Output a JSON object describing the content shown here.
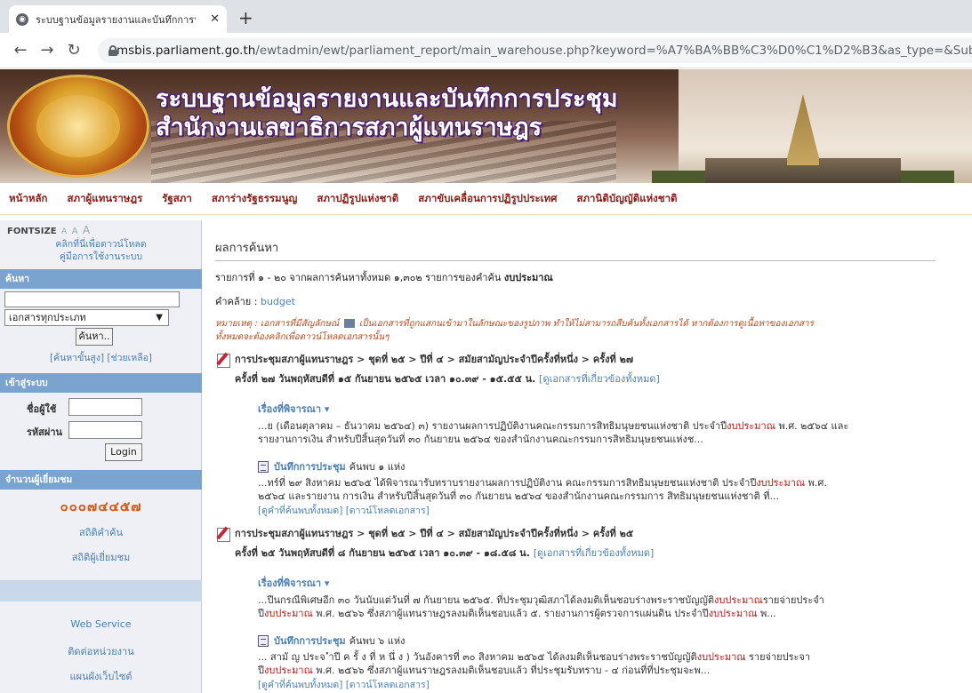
{
  "browser": {
    "tab_title": "ระบบฐานข้อมูลรายงานและบันทึกการประชุม",
    "url_host": "msbis.parliament.go.th",
    "url_path": "/ewtadmin/ewt/parliament_report/main_warehouse.php?keyword=%A7%BA%BB%C3%D0%C1%D2%B3&as_type=&Submit=%A"
  },
  "banner": {
    "title_line1": "ระบบฐานข้อมูลรายงานและบันทึกการประชุม",
    "title_line2": "สำนักงานเลขาธิการสภาผู้แทนราษฎร"
  },
  "topnav": [
    "หน้าหลัก",
    "สภาผู้แทนราษฎร",
    "รัฐสภา",
    "สภาร่างรัฐธรรมนูญ",
    "สภาปฏิรูปแห่งชาติ",
    "สภาขับเคลื่อนการปฏิรูปประเทศ",
    "สภานิติบัญญัติแห่งชาติ"
  ],
  "sidebar": {
    "fontsize_label": "FONTSIZE",
    "fontsize_options": [
      "A",
      "A",
      "A"
    ],
    "manual_line1": "คลิกที่นี่เพื่อดาวน์โหลด",
    "manual_line2": "คู่มือการใช้งานระบบ",
    "search_head": "ค้นหา",
    "search_value": "",
    "doc_type_selected": "เอกสารทุกประเภท",
    "search_button": "ค้นหา..",
    "adv_search": "[ค้นหาขั้นสูง]",
    "help": "[ช่วยเหลือ]",
    "login_head": "เข้าสู่ระบบ",
    "username_label": "ชื่อผู้ใช้",
    "password_label": "รหัสผ่าน",
    "login_button": "Login",
    "visitors_head": "จำนวนผู้เยี่ยมชม",
    "visitor_count": "๐๐๐๗๔๔๕๗",
    "search_stats": "สถิติคำค้น",
    "visitor_stats": "สถิติผู้เยี่ยมชม",
    "web_service": "Web Service",
    "contact": "ติดต่อหน่วยงาน",
    "sitemap": "แผนผังเว็บไซต์"
  },
  "main": {
    "title": "ผลการค้นหา",
    "summary_prefix": "รายการที่ ๑ - ๒๐ จากผลการค้นหาทั้งหมด ๑,๓๐๒ รายการของคำค้น ",
    "summary_keyword": "งบประมาณ",
    "similar_label": "คำคล้าย : ",
    "similar_word": "budget",
    "note_prefix": "หมายเหตุ : เอกสารที่มีสัญลักษณ์",
    "note_suffix": "เป็นเอกสารที่ถูกแสกนเข้ามาในลักษณะของรูปภาพ ทำให้ไม่สามารถสืบค้นทั้งเอกสารได้ หากต้องการดูเนื้อหาของเอกสาร",
    "note_line2": "ทั้งหมดจะต้องคลิกเพื่อดาวน์โหลดเอกสารนั้นๆ",
    "results": [
      {
        "path": "การประชุมสภาผู้แทนราษฎร > ชุดที่ ๒๕ > ปีที่ ๔ > สมัยสามัญประจำปีครั้งที่หนึ่ง > ครั้งที่ ๒๗",
        "session": "ครั้งที่ ๒๗ วันพฤหัสบดีที่ ๑๕ กันยายน ๒๕๖๕ เวลา ๑๐.๓๙ - ๑๕.๕๕ น. ",
        "related_link": "[ดูเอกสารที่เกี่ยวข้องทั้งหมด]",
        "topic_label": "เรื่องที่พิจารณา ▾",
        "topic_s1": "...ย (เดือนตุลาคม – ธันวาคม ๒๕๖๔) ๓) รายงานผลการปฏิบัติงานคณะกรรมการสิทธิมนุษยชนแห่งชาติ ประจำปี",
        "topic_hl": "งบประมาณ",
        "topic_s2": " พ.ศ. ๒๕๖๔ และ",
        "topic_line2": "รายงานการเงิน สำหรับปีสิ้นสุดวันที่ ๓๐ กันยายน ๒๕๖๔ ของสำนักงานคณะกรรมการสิทธิมนุษยชนแห่งช...",
        "minutes_label": "บันทึกการประชุม",
        "minutes_found": "ค้นพบ ๑ แห่ง",
        "minutes_s1": "...ทร์ที่ ๒๙ สิงหาคม ๒๕๖๕ ได้พิจารณารับทราบรายงานผลการปฏิบัติงาน คณะกรรมการสิทธิมนุษยชนแห่งชาติ ประจำปี",
        "minutes_hl": "งบประมาณ",
        "minutes_s2": " พ.ศ.",
        "minutes_line2": "๒๕๖๔ และรายงาน การเงิน สำหรับปีสิ้นสุดวันที่ ๓๐ กันยายน ๒๕๖๔ ของสำนักงานคณะกรรมการ สิทธิมนุษยชนแห่งชาติ ที่...",
        "view_all": "[ดูคำที่ค้นพบทั้งหมด]",
        "download": "[ดาวน์โหลดเอกสาร]"
      },
      {
        "path": "การประชุมสภาผู้แทนราษฎร > ชุดที่ ๒๕ > ปีที่ ๔ > สมัยสามัญประจำปีครั้งที่หนึ่ง > ครั้งที่ ๒๕",
        "session": "ครั้งที่ ๒๕ วันพฤหัสบดีที่ ๘ กันยายน ๒๕๖๕ เวลา ๑๐.๓๙ - ๑๘.๕๘ น. ",
        "related_link": "[ดูเอกสารที่เกี่ยวข้องทั้งหมด]",
        "topic_label": "เรื่องที่พิจารณา ▾",
        "topic_s1": "...ปีนกรณีพิเศษอีก ๓๐ วันนับแต่วันที่ ๗ กันยายน ๒๕๖๕. ที่ประชุมวุฒิสภาได้ลงมติเห็นชอบร่างพระราชบัญญัติ",
        "topic_hl": "งบประมาณ",
        "topic_s2": "รายจ่ายประจำ",
        "topic_line2_pre": "ปี",
        "topic_line2_hl": "งบประมาณ",
        "topic_line2_mid": " พ.ศ. ๒๕๖๖ ซึ่งสภาผู้แทนราษฎรลงมติเห็นชอบแล้ว ๕. รายงานการผู้ตรวจการแผ่นดิน ประจำปี",
        "topic_line2_hl2": "งบประมาณ",
        "topic_line2_post": " พ...",
        "minutes_label": "บันทึกการประชุม",
        "minutes_found": "ค้นพบ ๖ แห่ง",
        "minutes_s1": "... สามั ญ ประจ ำปี ค รั้ ง ที่ ห นึ่ ง ) วันอังคารที่ ๓๐ สิงหาคม ๒๕๖๕ ได้ลงมติเห็นชอบร่างพระราชบัญญัติ",
        "minutes_hl": "งบประมาณ",
        "minutes_s2": " รายจ่ายประจา",
        "minutes_line2_pre": "ปี",
        "minutes_line2_hl": "งบประมาณ",
        "minutes_line2_post": " พ.ศ. ๒๕๖๖ ซึ่งสภาผู้แทนราษฎรลงมติเห็นชอบแล้ว ที่ประชุมรับทราบ - ๔ ก่อนที่ที่ประชุมจะพ...",
        "view_all": "[ดูคำที่ค้นพบทั้งหมด]",
        "download": "[ดาวน์โหลดเอกสาร]"
      }
    ]
  }
}
